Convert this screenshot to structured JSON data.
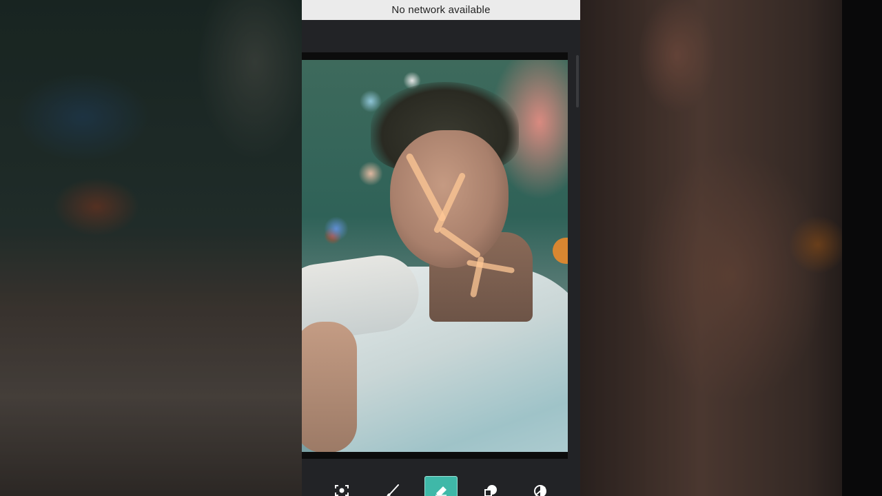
{
  "status": {
    "network_message": "No network available"
  },
  "toolbar": {
    "tools": [
      {
        "icon": "focus-icon",
        "active": false
      },
      {
        "icon": "brush-icon",
        "active": false
      },
      {
        "icon": "eraser-icon",
        "active": true
      },
      {
        "icon": "shapes-icon",
        "active": false
      },
      {
        "icon": "invert-icon",
        "active": false
      }
    ]
  },
  "colors": {
    "accent": "#3fb8a8",
    "panel": "#222326",
    "banner": "#ebebeb",
    "brush_stroke": "#ffc896",
    "handle": "#e98a2b"
  }
}
